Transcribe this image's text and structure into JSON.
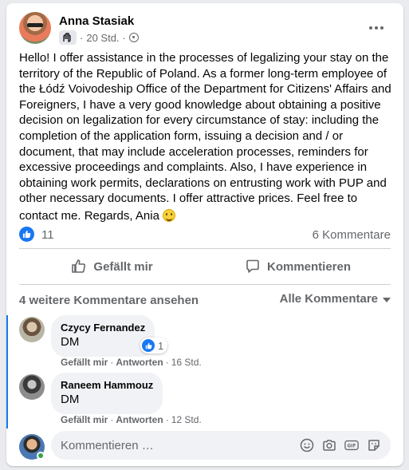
{
  "post": {
    "author": "Anna Stasiak",
    "time": "20 Std.",
    "separator": "·",
    "text": "Hello! I offer assistance in the processes of legalizing your stay on the territory of the Republic of Poland.  As a former long-term employee of the Łódź Voivodeship Office of the Department for Citizens' Affairs and Foreigners, I have a very good knowledge about obtaining a positive decision on legalization for every circumstance of stay: including the completion of  the application form, issuing a decision and / or document, that may include acceleration processes, reminders for excessive proceedings and complaints. Also, I have experience in obtaining work permits, declarations on entrusting work with PUP and other necessary documents. I offer attractive prices.  Feel free to contact me.  Regards, Ania",
    "more_icon": "more-horizontal-icon"
  },
  "stats": {
    "likes": "11",
    "comments": "6 Kommentare"
  },
  "actions": {
    "like": "Gefällt mir",
    "comment": "Kommentieren"
  },
  "comments_section": {
    "more_label": "4 weitere Kommentare ansehen",
    "filter_label": "Alle Kommentare"
  },
  "comments": [
    {
      "name": "Czycy Fernandez",
      "text": "DM",
      "reaction_count": "1",
      "like": "Gefällt mir",
      "reply": "Antworten",
      "time": "16 Std."
    },
    {
      "name": "Raneem Hammouz",
      "text": "DM",
      "like": "Gefällt mir",
      "reply": "Antworten",
      "time": "12 Std."
    }
  ],
  "reply": {
    "placeholder": "Kommentieren …"
  },
  "colors": {
    "accent": "#1877f2",
    "muted": "#65676b",
    "bubble": "#f0f2f5",
    "online": "#31a24c"
  }
}
